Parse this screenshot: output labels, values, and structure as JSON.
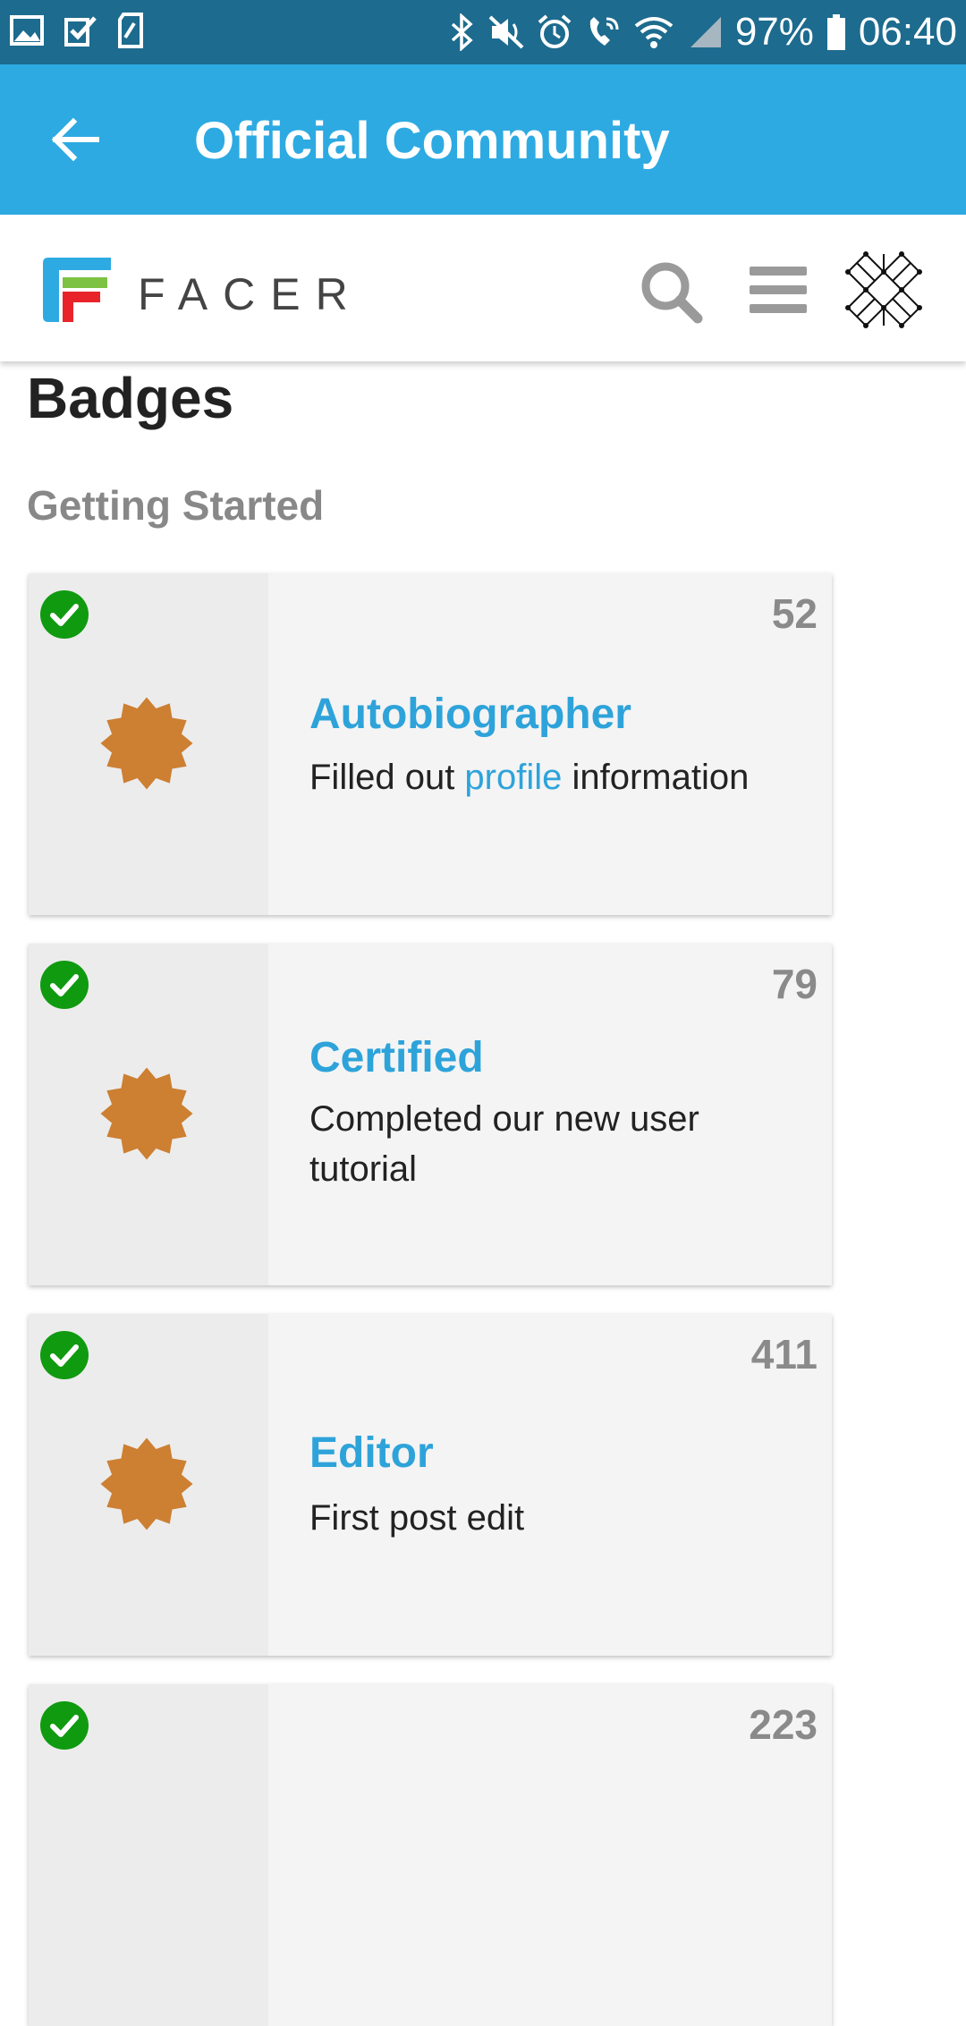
{
  "status_bar": {
    "battery": "97%",
    "time": "06:40",
    "icons": [
      "image-icon",
      "checkbox-icon",
      "sd-card-icon",
      "bluetooth-icon",
      "mute-icon",
      "alarm-icon",
      "wifi-call-icon",
      "wifi-icon",
      "signal-icon",
      "battery-icon"
    ]
  },
  "app_bar": {
    "title": "Official Community"
  },
  "site_header": {
    "logo_text": "FACER"
  },
  "page": {
    "title": "Badges",
    "section": "Getting Started"
  },
  "badges": [
    {
      "name": "Autobiographer",
      "desc_before": "Filled out ",
      "desc_link": "profile",
      "desc_after": " information",
      "count": "52"
    },
    {
      "name": "Certified",
      "desc": "Completed our new user tutorial",
      "count": "79"
    },
    {
      "name": "Editor",
      "desc": "First post edit",
      "count": "411"
    },
    {
      "count": "223"
    }
  ],
  "colors": {
    "status_bar": "#1d6b8e",
    "app_bar": "#2eaae2",
    "accent": "#2ea3da",
    "badge_bronze": "#cd7f32",
    "check": "#109a10"
  }
}
